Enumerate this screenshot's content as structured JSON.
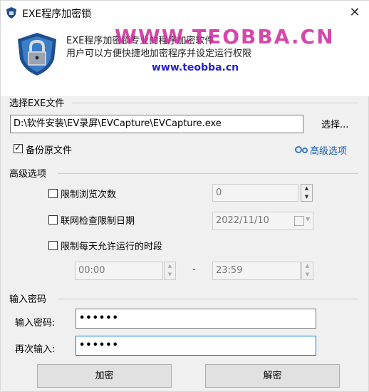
{
  "window": {
    "title": "EXE程序加密锁",
    "close_glyph": "✕"
  },
  "header": {
    "line1": "EXE程序加密锁专业的程序加密软件",
    "line2": "用户可以方便快捷地加密程序并设定运行权限",
    "watermark": "WWW.TEOBBA.CN",
    "watermark_url": "www.teobba.cn"
  },
  "file_section": {
    "title": "选择EXE文件",
    "path": "D:\\软件安装\\EV录屏\\EVCapture\\EVCapture.exe",
    "browse_label": "选择...",
    "backup_label": "备份原文件",
    "backup_checked": true,
    "advanced_link": "高级选项"
  },
  "advanced": {
    "title": "高级选项",
    "limit_views_label": "限制浏览次数",
    "limit_views_value": "0",
    "net_date_label": "联网检查限制日期",
    "net_date_value": "2022/11/10",
    "daily_time_label": "限制每天允许运行的时段",
    "time_start": "00:00",
    "time_dash": "-",
    "time_end": "23:59"
  },
  "password": {
    "title": "输入密码",
    "pw_label": "输入密码:",
    "pw_value": "••••••",
    "repeat_label": "再次输入:",
    "repeat_value": "••••••"
  },
  "actions": {
    "encrypt": "加密",
    "decrypt": "解密"
  },
  "colors": {
    "watermark_magenta": "#d0289e",
    "watermark_blue": "#2222cc",
    "link_blue": "#1a5fb4"
  }
}
